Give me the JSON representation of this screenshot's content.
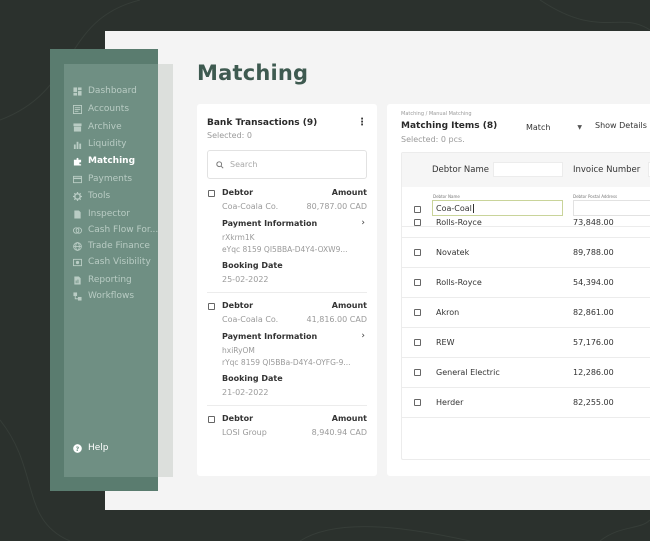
{
  "colors": {
    "background": "#2b312d",
    "sidebar": "#6f8f83",
    "sidebar_outer": "#5a7c6f",
    "title": "#3e5a50",
    "panel": "#f4f4f4"
  },
  "sidebar": {
    "items": [
      {
        "label": "Dashboard",
        "icon": "dashboard-icon"
      },
      {
        "label": "Accounts",
        "icon": "accounts-icon"
      },
      {
        "label": "Archive",
        "icon": "archive-icon"
      },
      {
        "label": "Liquidity",
        "icon": "chart-icon"
      },
      {
        "label": "Matching",
        "icon": "puzzle-icon",
        "active": true
      },
      {
        "label": "Payments",
        "icon": "card-icon"
      },
      {
        "label": "Tools",
        "icon": "gear-icon"
      },
      {
        "label": "Inspector",
        "icon": "document-icon"
      },
      {
        "label": "Cash Flow For...",
        "icon": "cashflow-icon"
      },
      {
        "label": "Trade Finance",
        "icon": "globe-icon"
      },
      {
        "label": "Cash Visibility",
        "icon": "eye-icon"
      },
      {
        "label": "Reporting",
        "icon": "report-icon"
      },
      {
        "label": "Workflows",
        "icon": "workflow-icon"
      }
    ],
    "help": "Help"
  },
  "page": {
    "title": "Matching"
  },
  "bank_transactions": {
    "title": "Bank Transactions (9)",
    "selected": "Selected: 0",
    "search_placeholder": "Search",
    "labels": {
      "debtor": "Debtor",
      "amount": "Amount",
      "payment_info": "Payment Information",
      "booking_date": "Booking Date"
    },
    "items": [
      {
        "debtor": "Coa-Coala Co.",
        "amount": "80,787.00 CAD",
        "pi_line1": "rXkrm1K",
        "pi_line2": "eYqc 8159 QI5BBA-D4Y4-OXW9...",
        "booking_date": "25-02-2022"
      },
      {
        "debtor": "Coa-Coala Co.",
        "amount": "41,816.00 CAD",
        "pi_line1": "hxiRyOM",
        "pi_line2": "rYqc 8159 QI5BBa-D4Y4-OYFG-9...",
        "booking_date": "21-02-2022"
      },
      {
        "debtor": "LOSI Group",
        "amount": "8,940.94 CAD"
      }
    ]
  },
  "matching": {
    "breadcrumb": "Matching  /  Manual Matching",
    "title": "Matching Items (8)",
    "selected": "Selected: 0 pcs.",
    "mode": "Match",
    "show_details": "Show Details",
    "columns": {
      "debtor_name": "Debtor Name",
      "invoice_number": "Invoice Number"
    },
    "filter": {
      "debtor_label": "Debtor Name",
      "debtor_value": "Coa-Coal",
      "postal_label": "Debtor Postal Address"
    },
    "rows": [
      {
        "name": "Rolls-Royce",
        "invoice": "73,848.00"
      },
      {
        "name": "Novatek",
        "invoice": "89,788.00"
      },
      {
        "name": "Rolls-Royce",
        "invoice": "54,394.00"
      },
      {
        "name": "Akron",
        "invoice": "82,861.00"
      },
      {
        "name": "REW",
        "invoice": "57,176.00"
      },
      {
        "name": "General Electric",
        "invoice": "12,286.00"
      },
      {
        "name": "Herder",
        "invoice": "82,255.00"
      }
    ]
  }
}
